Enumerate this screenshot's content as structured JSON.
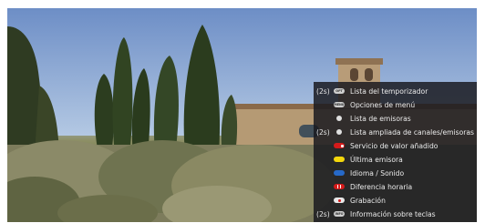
{
  "menu": {
    "items": [
      {
        "prefix": "(2s)",
        "key": "grey",
        "key_text": "OPT",
        "label": "Lista del temporizador"
      },
      {
        "prefix": "",
        "key": "grey",
        "key_text": "MENU",
        "label": "Opciones de menú"
      },
      {
        "prefix": "",
        "key": "dot",
        "key_text": "",
        "label": "Lista de emisoras"
      },
      {
        "prefix": "(2s)",
        "key": "dot",
        "key_text": "",
        "label": "Lista ampliada de canales/emisoras"
      },
      {
        "prefix": "",
        "key": "red",
        "key_text": "",
        "label": "Servicio de valor añadido"
      },
      {
        "prefix": "",
        "key": "yellow",
        "key_text": "",
        "label": "Última emisora"
      },
      {
        "prefix": "",
        "key": "blue",
        "key_text": "",
        "label": "Idioma / Sonido"
      },
      {
        "prefix": "",
        "key": "redwhite",
        "key_text": "",
        "label": "Diferencia horaria"
      },
      {
        "prefix": "",
        "key": "rec",
        "key_text": "",
        "label": "Grabación"
      },
      {
        "prefix": "(2s)",
        "key": "grey",
        "key_text": "INFO",
        "label": "Información sobre teclas"
      }
    ]
  },
  "colors": {
    "menu_background": "#18181e",
    "key_red": "#d51a1a",
    "key_yellow": "#f3d70c",
    "key_blue": "#2669c8"
  }
}
